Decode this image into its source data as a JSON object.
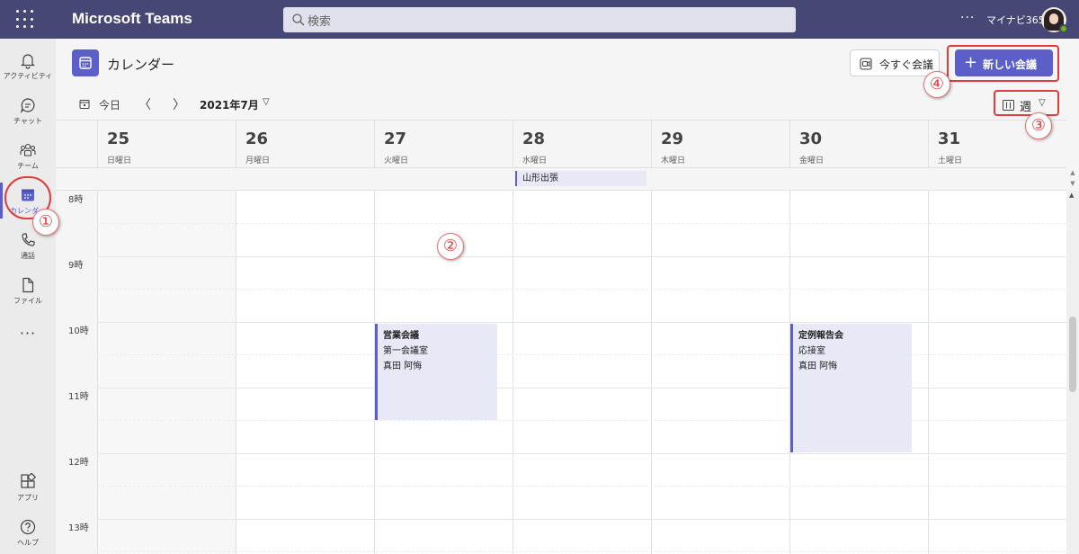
{
  "app": {
    "title": "Microsoft Teams",
    "search_placeholder": "検索",
    "more": "···",
    "user_name": "マイナビ365"
  },
  "rail": {
    "items": [
      {
        "label": "アクティビティ",
        "icon": "bell-icon"
      },
      {
        "label": "チャット",
        "icon": "chat-icon"
      },
      {
        "label": "チーム",
        "icon": "teams-icon"
      },
      {
        "label": "カレンダー",
        "icon": "calendar-icon",
        "active": true
      },
      {
        "label": "通話",
        "icon": "phone-icon"
      },
      {
        "label": "ファイル",
        "icon": "file-icon"
      }
    ],
    "more": "···",
    "apps_label": "アプリ",
    "help_label": "ヘルプ"
  },
  "header": {
    "title": "カレンダー",
    "meet_now_label": "今すぐ会議",
    "new_meeting_label": "新しい会議"
  },
  "toolbar": {
    "today_label": "今日",
    "month_label": "2021年7月",
    "view_label": "週"
  },
  "days": [
    {
      "num": "25",
      "name": "日曜日"
    },
    {
      "num": "26",
      "name": "月曜日"
    },
    {
      "num": "27",
      "name": "火曜日"
    },
    {
      "num": "28",
      "name": "水曜日"
    },
    {
      "num": "29",
      "name": "木曜日"
    },
    {
      "num": "30",
      "name": "金曜日"
    },
    {
      "num": "31",
      "name": "土曜日"
    }
  ],
  "all_day_event": {
    "title": "山形出張",
    "day": "28"
  },
  "hours": [
    "8時",
    "9時",
    "10時",
    "11時",
    "12時",
    "13時"
  ],
  "events": [
    {
      "title": "営業会議",
      "location": "第一会議室",
      "organizer": "真田 阿悔",
      "day": "27",
      "start": "10:00",
      "end": "11:30"
    },
    {
      "title": "定例報告会",
      "location": "応接室",
      "organizer": "真田 阿悔",
      "day": "30",
      "start": "10:00",
      "end": "12:00"
    }
  ],
  "annotations": [
    "①",
    "②",
    "③",
    "④"
  ],
  "colors": {
    "topbar": "#464775",
    "accent": "#5b5fc7",
    "event_bg": "#e8e8f7",
    "annotation_red": "#e03c3c"
  }
}
